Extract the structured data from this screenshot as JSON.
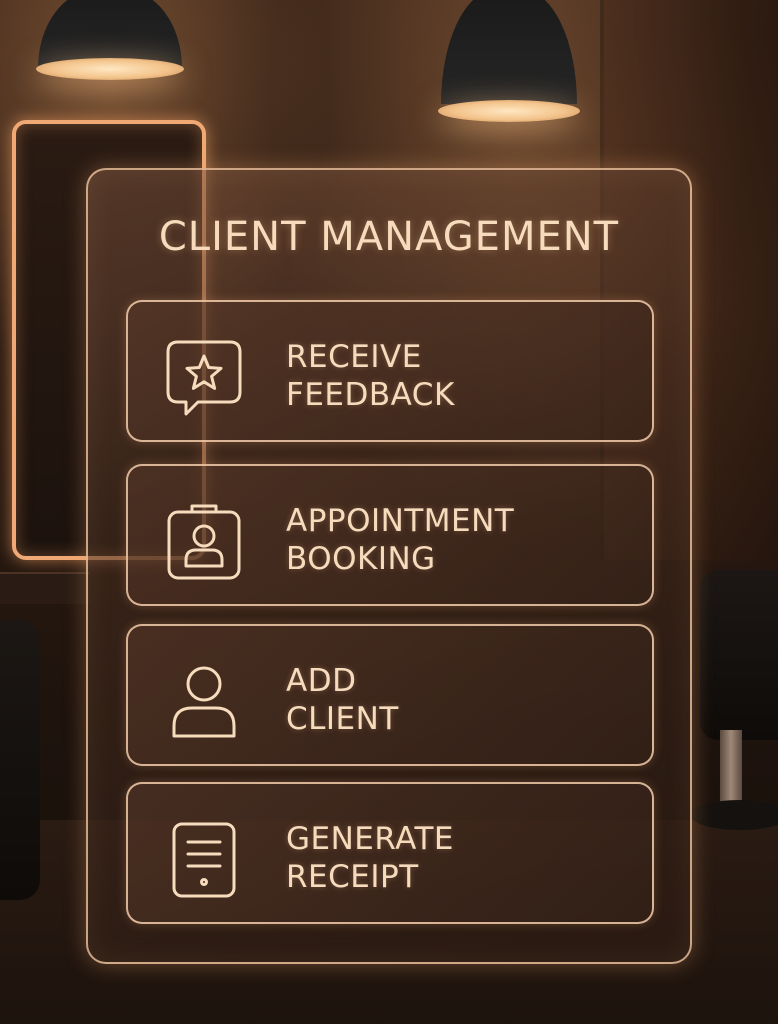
{
  "panel": {
    "title": "CLIENT MANAGEMENT",
    "accent_color": "#f6dcbd",
    "items": [
      {
        "icon": "star-feedback-icon",
        "line1": "RECEIVE",
        "line2": "FEEDBACK"
      },
      {
        "icon": "calendar-person-icon",
        "line1": "APPOINTMENT",
        "line2": "BOOKING"
      },
      {
        "icon": "user-icon",
        "line1": "ADD",
        "line2": "CLIENT"
      },
      {
        "icon": "receipt-icon",
        "line1": "GENERATE",
        "line2": "RECEIPT"
      }
    ]
  }
}
